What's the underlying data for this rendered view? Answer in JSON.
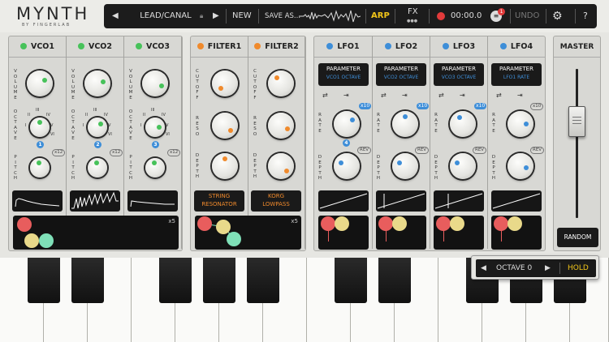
{
  "app": {
    "logo": "MYNTH",
    "logo_sub": "BY FINGERLAB"
  },
  "toolbar": {
    "preset_name": "LEAD/CANAL",
    "new_label": "NEW",
    "save_label": "SAVE AS...",
    "arp_label": "ARP",
    "fx_label": "FX",
    "time": "00:00.0",
    "notification_count": "1",
    "undo_label": "UNDO",
    "help_label": "?"
  },
  "vco": [
    {
      "name": "VCO1",
      "led": "#47c25a",
      "octave_value": "1",
      "pitch_range": "x12",
      "wave": "sine-decay"
    },
    {
      "name": "VCO2",
      "led": "#47c25a",
      "octave_value": "2",
      "pitch_range": "x12",
      "wave": "saw"
    },
    {
      "name": "VCO3",
      "led": "#47c25a",
      "octave_value": "3",
      "pitch_range": "x12",
      "wave": "ramp"
    }
  ],
  "vco_labels": {
    "volume": "VOLUME",
    "octave": "OCTAVE",
    "pitch": "PITCH",
    "oct_ticks": [
      "I",
      "II",
      "III",
      "IV",
      "V",
      "VI"
    ]
  },
  "vco_pad": {
    "multiplier": "x5"
  },
  "filters": [
    {
      "name": "FILTER1",
      "led": "#f08a2c",
      "type_line1": "STRING",
      "type_line2": "RESONATOR"
    },
    {
      "name": "FILTER2",
      "led": "#f08a2c",
      "type_line1": "KORG",
      "type_line2": "LOWPASS"
    }
  ],
  "filter_labels": {
    "cutoff": "CUTOFF",
    "reso": "RESO",
    "depth": "DEPTH"
  },
  "filter_pad": {
    "multiplier": "x5"
  },
  "lfos": [
    {
      "name": "LFO1",
      "led": "#3e8ed8",
      "param_title": "PARAMETER",
      "param_value": "VCO1 OCTAVE",
      "rate_range": "x10",
      "depth_mode": "REV",
      "step_value": "4"
    },
    {
      "name": "LFO2",
      "led": "#3e8ed8",
      "param_title": "PARAMETER",
      "param_value": "VCO2 OCTAVE",
      "rate_range": "x10",
      "depth_mode": "REV"
    },
    {
      "name": "LFO3",
      "led": "#3e8ed8",
      "param_title": "PARAMETER",
      "param_value": "VCO3 OCTAVE",
      "rate_range": "x10",
      "depth_mode": "REV"
    },
    {
      "name": "LFO4",
      "led": "#3e8ed8",
      "param_title": "PARAMETER",
      "param_value": "LFO1 RATE",
      "rate_range": "x10",
      "depth_mode": "REV"
    }
  ],
  "lfo_labels": {
    "rate": "RATE",
    "depth": "DEPTH"
  },
  "master": {
    "title": "MASTER",
    "random_label": "RANDOM"
  },
  "keyboard": {
    "octave_label": "OCTAVE 0",
    "hold_label": "HOLD"
  },
  "colors": {
    "green": "#47c25a",
    "orange": "#f08a2c",
    "blue": "#3e8ed8",
    "yellow": "#f0c419",
    "pad_red": "#e85d5d",
    "pad_yellow": "#e9d98a",
    "pad_teal": "#7fe0b8"
  }
}
